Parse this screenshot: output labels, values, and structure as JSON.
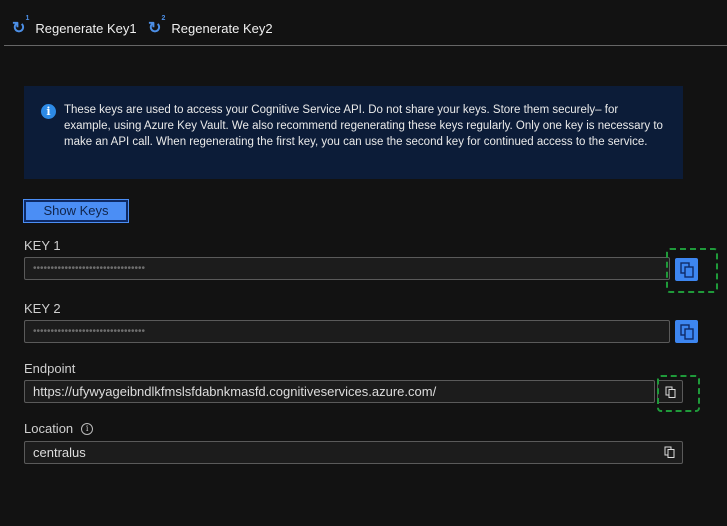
{
  "toolbar": {
    "regen1": "Regenerate Key1",
    "regen2": "Regenerate Key2",
    "sup1": "1",
    "sup2": "2"
  },
  "info": {
    "icon": "i",
    "text": "These keys are used to access your Cognitive Service API. Do not share your keys. Store them securely– for example, using Azure Key Vault. We also recommend regenerating these keys regularly. Only one key is necessary to make an API call. When regenerating the first key, you can use the second key for continued access to the service."
  },
  "show_keys": "Show Keys",
  "key1": {
    "label": "KEY 1",
    "value": "••••••••••••••••••••••••••••••••"
  },
  "key2": {
    "label": "KEY 2",
    "value": "••••••••••••••••••••••••••••••••"
  },
  "endpoint": {
    "label": "Endpoint",
    "value": "https://ufywyageibndlkfmslsfdabnkmasfd.cognitiveservices.azure.com/"
  },
  "location": {
    "label": "Location",
    "info": "i",
    "value": "centralus"
  },
  "colors": {
    "accent": "#4b8ef5",
    "info_bg": "#0c1c38",
    "annotation": "#1f9a3a"
  }
}
